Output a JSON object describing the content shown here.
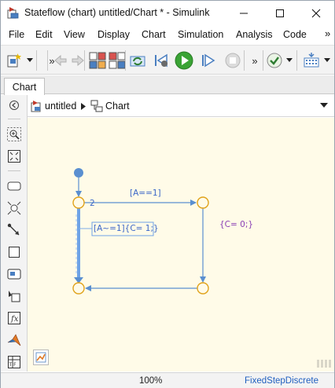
{
  "window": {
    "title": "Stateflow (chart) untitled/Chart * - Simulink"
  },
  "menu": {
    "items": [
      "File",
      "Edit",
      "View",
      "Display",
      "Chart",
      "Simulation",
      "Analysis",
      "Code"
    ],
    "overflow": "»"
  },
  "toolbar": {
    "overflow": "»"
  },
  "tabs": {
    "active": "Chart"
  },
  "breadcrumb": {
    "model": "untitled",
    "chart": "Chart"
  },
  "chart": {
    "junction_order": "2",
    "transition_top": "[A==1]",
    "transition_left": "[A~=1]{C= 1;}",
    "action_right": "{C= 0;}"
  },
  "status": {
    "zoom": "100%",
    "solver": "FixedStepDiscrete"
  },
  "colors": {
    "canvas": "#fffbe8",
    "junction": "#e0a21a",
    "transition": "#5a8fd0",
    "label_text": "#3b67c8",
    "action_text": "#8a3fb5"
  }
}
